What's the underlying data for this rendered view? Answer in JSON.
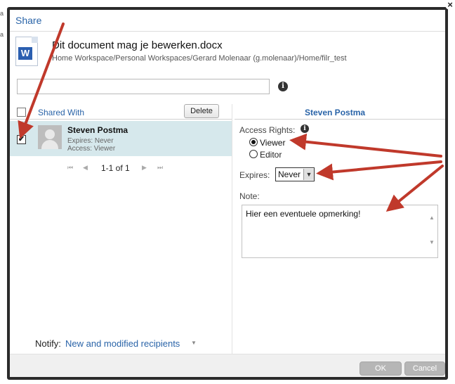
{
  "dialog": {
    "title": "Share",
    "close_glyph": "×",
    "stray_chars": [
      "a",
      "a"
    ],
    "accent_color": "#2a64a8",
    "annotation_color": "#c0392b"
  },
  "document": {
    "icon": "word-document-icon",
    "icon_letter": "W",
    "name": "Dit document mag je bewerken.docx",
    "path": "Home Workspace/Personal Workspaces/Gerard Molenaar (g.molenaar)/Home/filr_test"
  },
  "search": {
    "value": "",
    "placeholder": "",
    "info_icon": "i"
  },
  "shared_list": {
    "header_label": "Shared With",
    "delete_label": "Delete",
    "rows": [
      {
        "checked": true,
        "check_glyph": "✔",
        "name": "Steven Postma",
        "expires": "Expires: Never",
        "access": "Access: Viewer"
      }
    ],
    "pagination": {
      "first": "⏮",
      "prev": "◀",
      "text": "1-1 of 1",
      "next": "▶",
      "last": "⏭"
    }
  },
  "details": {
    "header": "Steven Postma",
    "access_rights_label": "Access Rights:",
    "info_icon": "i",
    "options": [
      {
        "label": "Viewer",
        "selected": true
      },
      {
        "label": "Editor",
        "selected": false
      }
    ],
    "expires_label": "Expires:",
    "expires_value": "Never",
    "expires_arrow": "▼",
    "note_label": "Note:",
    "note_value": "Hier een eventuele opmerking!",
    "scroll_up": "▲",
    "scroll_down": "▼"
  },
  "notify": {
    "label": "Notify:",
    "value": "New and modified recipients",
    "caret": "▼"
  },
  "footer": {
    "ok_label": "OK",
    "cancel_label": "Cancel"
  }
}
